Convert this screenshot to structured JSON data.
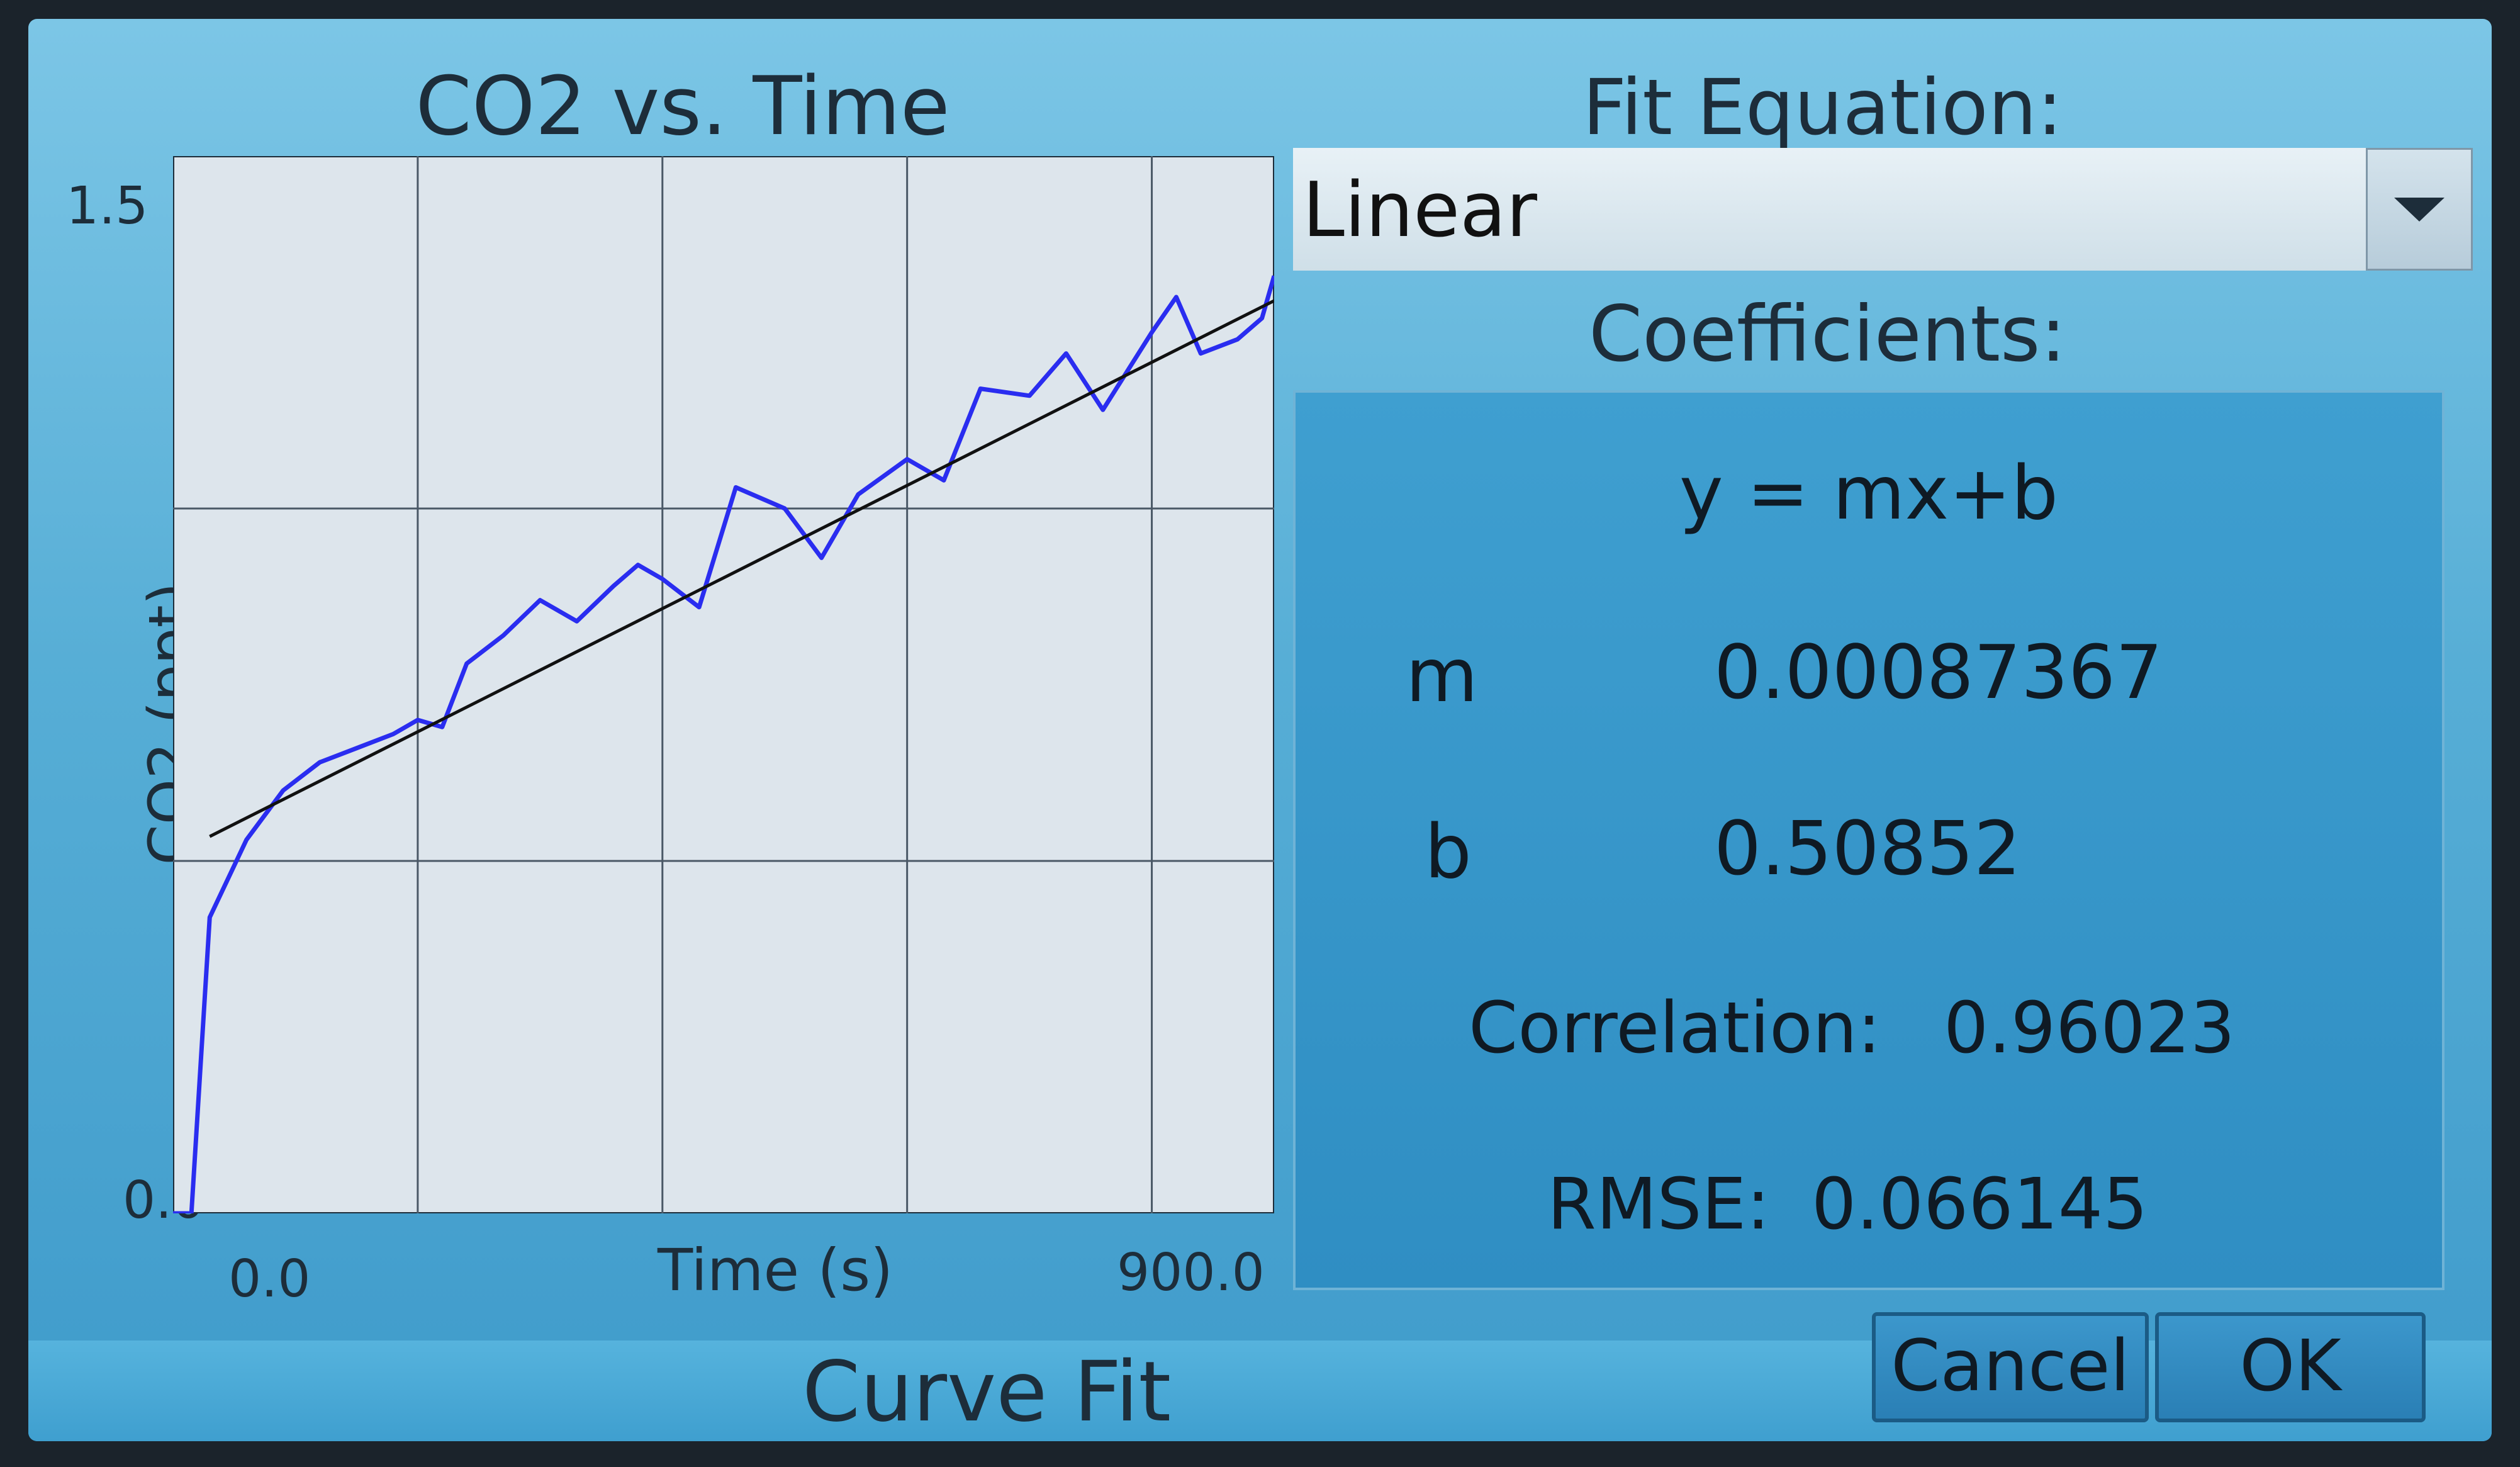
{
  "chart_data": {
    "type": "line",
    "title": "CO2 vs. Time",
    "xlabel": "Time (s)",
    "ylabel": "CO2 (ppt)",
    "xlim": [
      0,
      900
    ],
    "ylim": [
      0,
      1.5
    ],
    "tick_labels": {
      "x": [
        "0.0",
        "900.0"
      ],
      "y": [
        "1.5",
        "0.0"
      ]
    },
    "grid": true,
    "series": [
      {
        "color": "#2a2df0",
        "x": [
          0,
          15,
          30,
          60,
          90,
          120,
          150,
          180,
          200,
          220,
          240,
          270,
          300,
          330,
          360,
          380,
          400,
          430,
          460,
          500,
          530,
          560,
          600,
          630,
          660,
          700,
          730,
          760,
          800,
          820,
          840,
          870,
          890,
          900
        ],
        "y": [
          0.0,
          0.0,
          0.42,
          0.53,
          0.6,
          0.64,
          0.66,
          0.68,
          0.7,
          0.69,
          0.78,
          0.82,
          0.87,
          0.84,
          0.89,
          0.92,
          0.9,
          0.86,
          1.03,
          1.0,
          0.93,
          1.02,
          1.07,
          1.04,
          1.17,
          1.16,
          1.22,
          1.14,
          1.25,
          1.3,
          1.22,
          1.24,
          1.27,
          1.33
        ]
      },
      {
        "color": "#111111",
        "x": [
          30,
          900
        ],
        "y": [
          0.5347,
          1.2948
        ]
      }
    ]
  },
  "fit": {
    "equation_label": "Fit Equation:",
    "selected": "Linear",
    "coefficients_label": "Coefficients:",
    "equation": "y = mx+b",
    "m_label": "m",
    "m_value": "0.00087367",
    "b_label": "b",
    "b_value": "0.50852",
    "correlation_label": "Correlation:",
    "correlation_value": "0.96023",
    "rmse_label": "RMSE:",
    "rmse_value": "0.066145"
  },
  "footer": {
    "title": "Curve Fit",
    "cancel_label": "Cancel",
    "ok_label": "OK"
  },
  "icons": {
    "dropdown": "chevron-down-icon"
  }
}
